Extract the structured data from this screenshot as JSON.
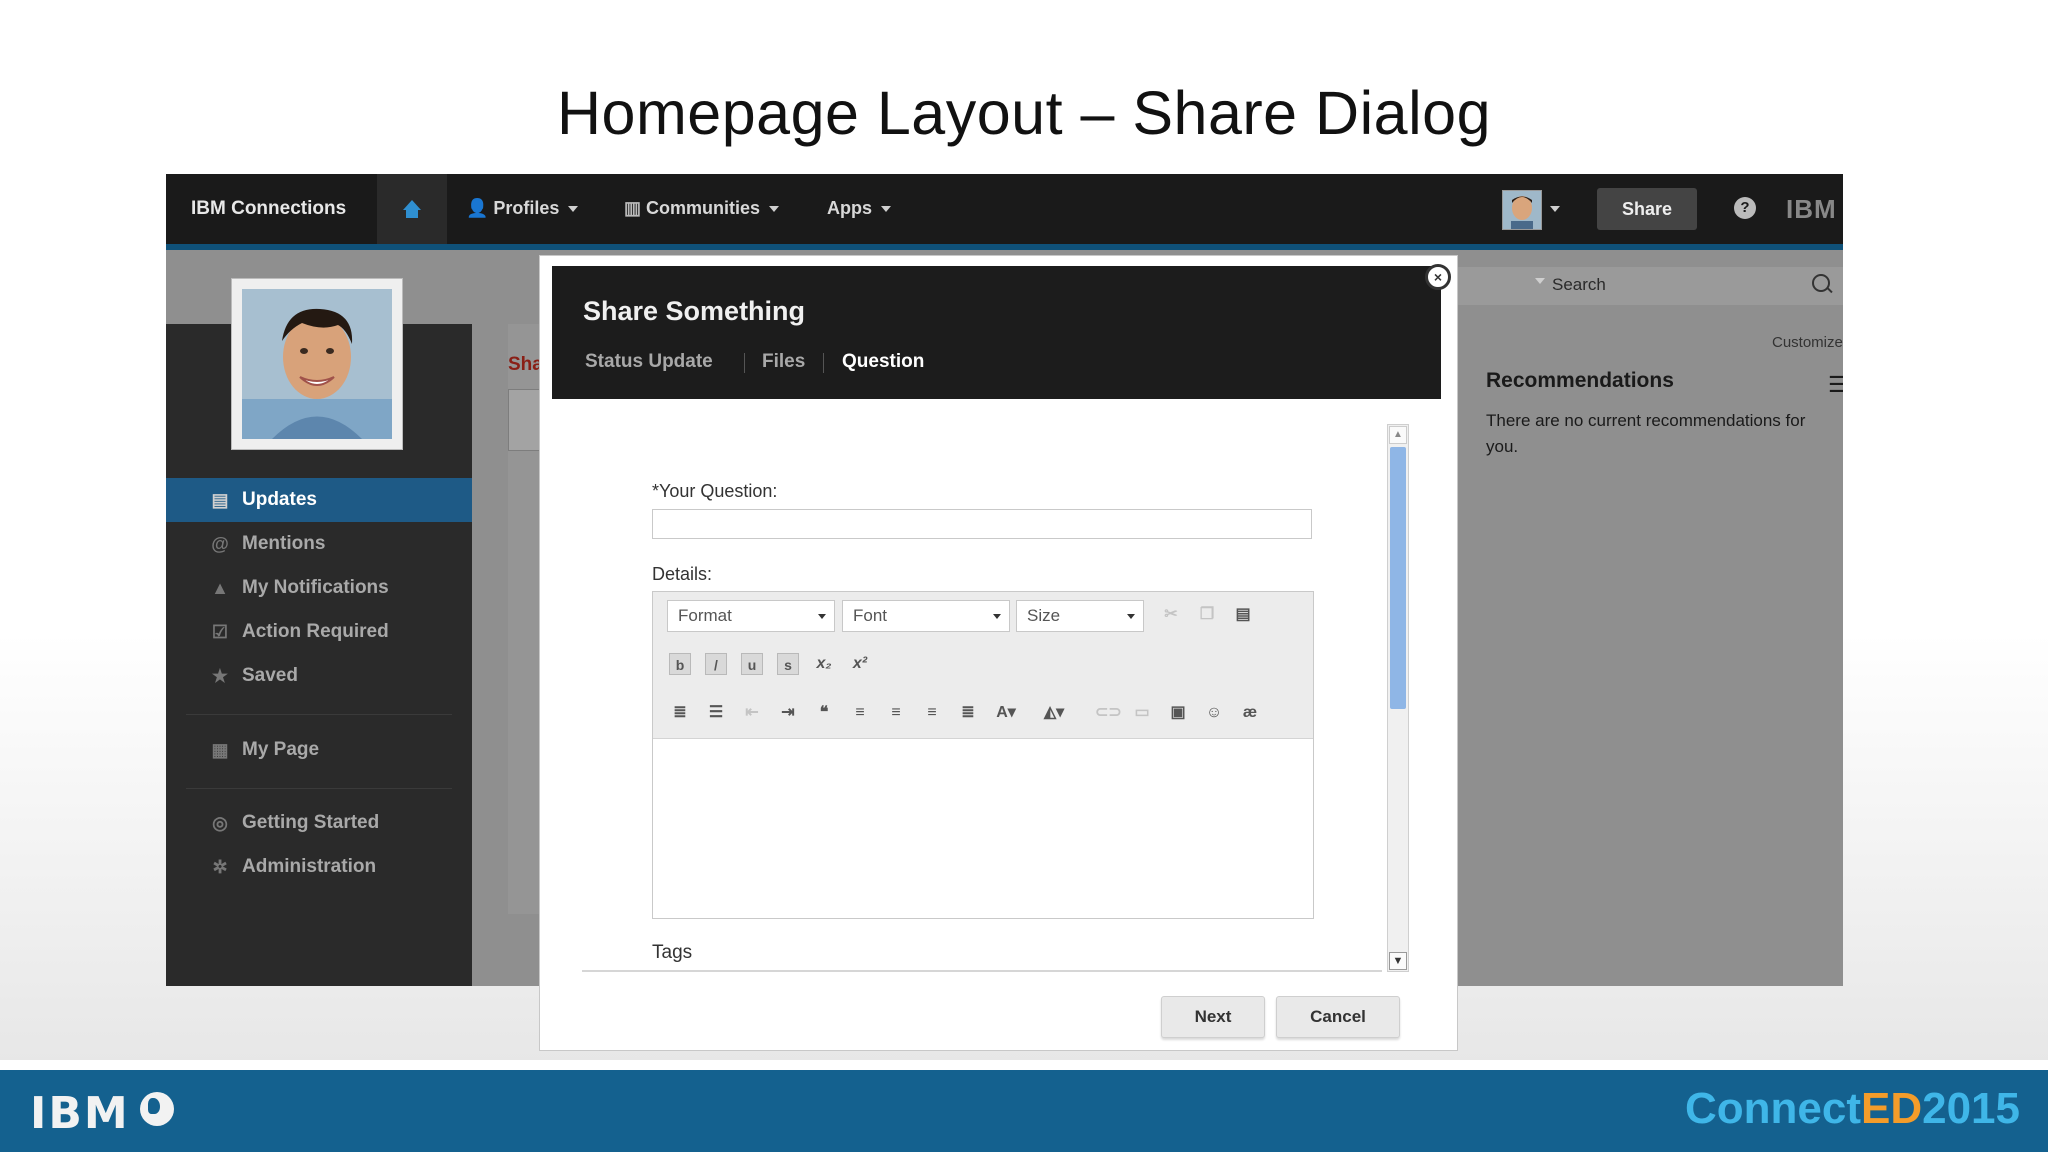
{
  "slide": {
    "title": "Homepage Layout – Share Dialog"
  },
  "topnav": {
    "brand": "IBM Connections",
    "items": [
      {
        "label": "Profiles"
      },
      {
        "label": "Communities"
      },
      {
        "label": "Apps"
      }
    ],
    "share_label": "Share",
    "help_glyph": "?",
    "ibm_mark": "IBM"
  },
  "sidebar": {
    "items": [
      {
        "label": "Updates",
        "icon": "updates-icon",
        "glyph": "▤",
        "active": true
      },
      {
        "label": "Mentions",
        "icon": "at-icon",
        "glyph": "@"
      },
      {
        "label": "My Notifications",
        "icon": "bell-icon",
        "glyph": "🔔"
      },
      {
        "label": "Action Required",
        "icon": "clipboard-icon",
        "glyph": "☑"
      },
      {
        "label": "Saved",
        "icon": "star-icon",
        "glyph": "★"
      },
      {
        "label": "My Page",
        "icon": "widgets-icon",
        "glyph": "▦"
      },
      {
        "label": "Getting Started",
        "icon": "compass-icon",
        "glyph": "◎"
      },
      {
        "label": "Administration",
        "icon": "gear-icon",
        "glyph": "✲"
      }
    ]
  },
  "center": {
    "partial_heading": "Sha"
  },
  "right": {
    "search_placeholder": "Search",
    "customize": "Customize",
    "recommendations_title": "Recommendations",
    "recommendations_text": "There are no current recommendations for you."
  },
  "dialog": {
    "title": "Share Something",
    "tabs": [
      {
        "label": "Status Update"
      },
      {
        "label": "Files"
      },
      {
        "label": "Question",
        "active": true
      }
    ],
    "close_glyph": "×",
    "question_label": "*Your Question:",
    "question_value": "",
    "details_label": "Details:",
    "editor": {
      "format": "Format",
      "font": "Font",
      "size": "Size"
    },
    "tags_label": "Tags",
    "next_label": "Next",
    "cancel_label": "Cancel"
  },
  "footer": {
    "ibm_logo": "IBM",
    "conf_part1": "Connect",
    "conf_part2": "ED",
    "conf_part3": "2015"
  },
  "colors": {
    "nav_bg": "#1a1a1a",
    "active_item": "#1e5a86",
    "footer_bg": "#14618f",
    "conf_blue": "#3fb6e8",
    "conf_orange": "#f39c2a"
  }
}
